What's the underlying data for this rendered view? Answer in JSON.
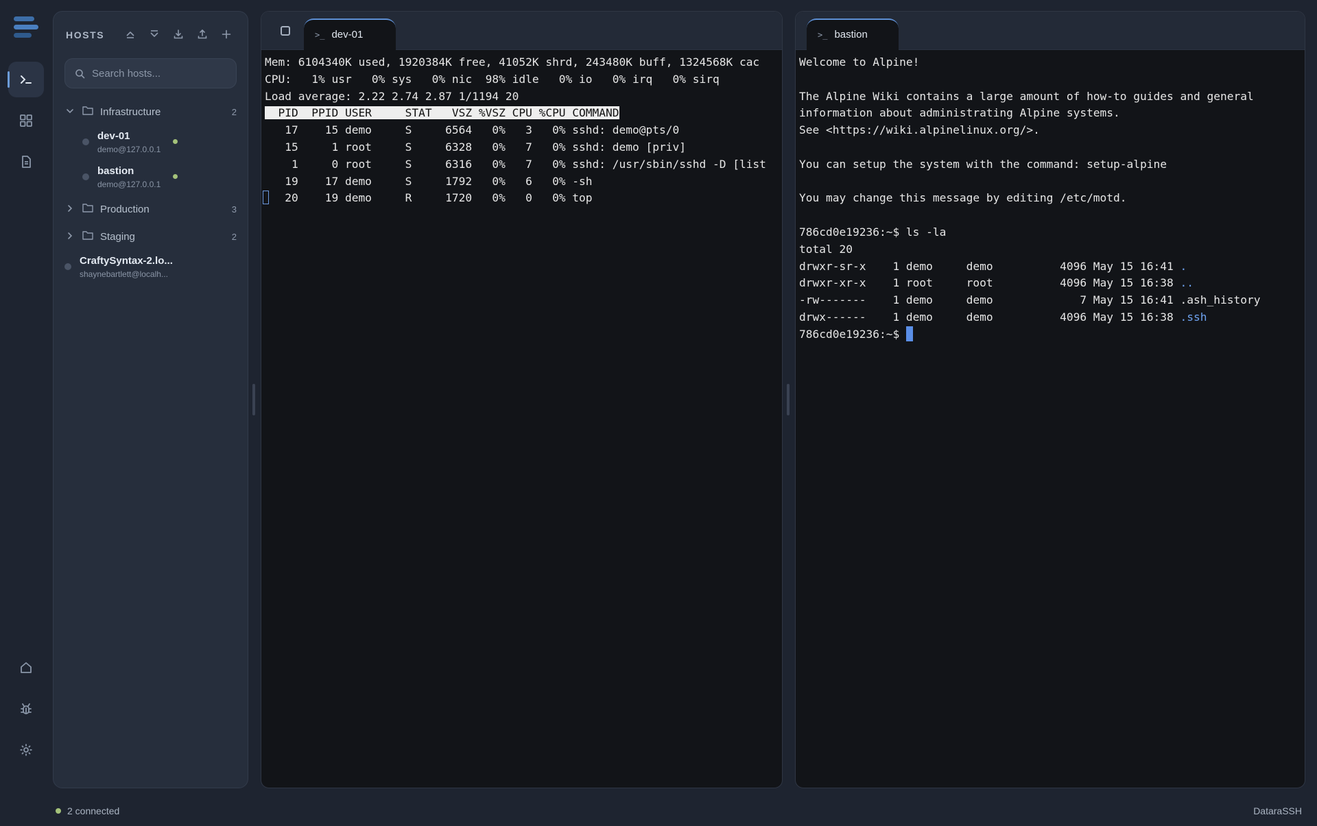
{
  "app": {
    "name": "DataraSSH"
  },
  "rail": {
    "items": [
      "terminal-icon",
      "grid-icon",
      "document-icon"
    ],
    "bottom": [
      "home-icon",
      "bug-icon",
      "gear-icon"
    ]
  },
  "hosts_panel": {
    "title": "HOSTS",
    "search_placeholder": "Search hosts...",
    "groups": [
      {
        "name": "Infrastructure",
        "count": "2",
        "expanded": true,
        "hosts": [
          {
            "name": "dev-01",
            "address": "demo@127.0.0.1",
            "online": true
          },
          {
            "name": "bastion",
            "address": "demo@127.0.0.1",
            "online": true
          }
        ]
      },
      {
        "name": "Production",
        "count": "3",
        "expanded": false
      },
      {
        "name": "Staging",
        "count": "2",
        "expanded": false
      }
    ],
    "ungrouped": [
      {
        "name": "CraftySyntax-2.lo...",
        "address": "shaynebartlett@localh..."
      }
    ]
  },
  "left_pane": {
    "tab": "dev-01",
    "lines": [
      "Mem: 6104340K used, 1920384K free, 41052K shrd, 243480K buff, 1324568K cac",
      "CPU:   1% usr   0% sys   0% nic  98% idle   0% io   0% irq   0% sirq",
      "Load average: 2.22 2.74 2.87 1/1194 20"
    ],
    "header_row": "  PID  PPID USER     STAT   VSZ %VSZ CPU %CPU COMMAND",
    "rows": [
      "   17    15 demo     S     6564   0%   3   0% sshd: demo@pts/0",
      "   15     1 root     S     6328   0%   7   0% sshd: demo [priv]",
      "    1     0 root     S     6316   0%   7   0% sshd: /usr/sbin/sshd -D [list",
      "   19    17 demo     S     1792   0%   6   0% -sh"
    ],
    "last_row": "   20    19 demo     R     1720   0%   0   0% top"
  },
  "right_pane": {
    "tab": "bastion",
    "lines": [
      "Welcome to Alpine!",
      "",
      "The Alpine Wiki contains a large amount of how-to guides and general",
      "information about administrating Alpine systems.",
      "See <https://wiki.alpinelinux.org/>.",
      "",
      "You can setup the system with the command: setup-alpine",
      "",
      "You may change this message by editing /etc/motd.",
      "",
      "786cd0e19236:~$ ls -la",
      "total 20"
    ],
    "listing": [
      {
        "prefix": "drwxr-sr-x    1 demo     demo          4096 May 15 16:41 ",
        "name": ".",
        "dir": true
      },
      {
        "prefix": "drwxr-xr-x    1 root     root          4096 May 15 16:38 ",
        "name": "..",
        "dir": true
      },
      {
        "prefix": "-rw-------    1 demo     demo             7 May 15 16:41 ",
        "name": ".ash_history",
        "dir": false
      },
      {
        "prefix": "drwx------    1 demo     demo          4096 May 15 16:38 ",
        "name": ".ssh",
        "dir": true
      }
    ],
    "prompt": "786cd0e19236:~$ "
  },
  "status_bar": {
    "connected": "2 connected",
    "brand": "DataraSSH"
  },
  "colors": {
    "accent": "#5d8fd4",
    "online": "#a4c27a",
    "dir": "#6ea2ef"
  }
}
